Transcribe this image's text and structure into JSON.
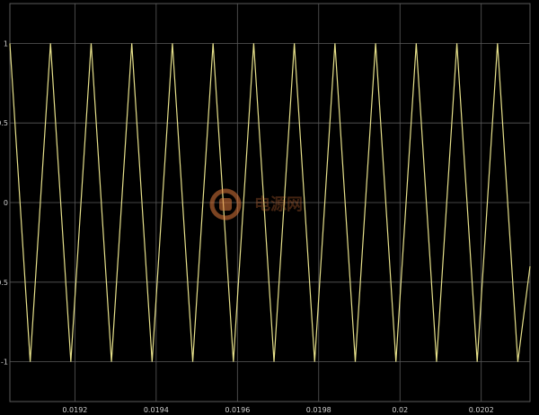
{
  "chart_data": {
    "type": "line",
    "title": "",
    "xlabel": "",
    "ylabel": "",
    "xlim": [
      0.01904,
      0.02032
    ],
    "ylim": [
      -1.25,
      1.25
    ],
    "grid": true,
    "x_ticks": [
      0.0192,
      0.0194,
      0.0196,
      0.0198,
      0.02,
      0.0202
    ],
    "x_tick_labels": [
      "0.0192",
      "0.0194",
      "0.0196",
      "0.0198",
      "0.02",
      "0.0202"
    ],
    "y_ticks": [
      1,
      0.5,
      0,
      -0.5,
      -1
    ],
    "y_tick_labels": [
      "1",
      "0.5",
      "0",
      "-0.5",
      "-1"
    ],
    "series": [
      {
        "color": "#e6e08a",
        "x": [
          0.01904,
          0.01909,
          0.01914,
          0.01919,
          0.01924,
          0.01929,
          0.01934,
          0.01939,
          0.01944,
          0.01949,
          0.01954,
          0.01959,
          0.01964,
          0.01969,
          0.01974,
          0.01979,
          0.01984,
          0.01989,
          0.01994,
          0.01999,
          0.02004,
          0.02009,
          0.02014,
          0.02019,
          0.02024,
          0.02029,
          0.02032
        ],
        "y": [
          1,
          -1,
          1,
          -1,
          1,
          -1,
          1,
          -1,
          1,
          -1,
          1,
          -1,
          1,
          -1,
          1,
          -1,
          1,
          -1,
          1,
          -1,
          1,
          -1,
          1,
          -1,
          1,
          -1,
          -0.4
        ]
      }
    ]
  },
  "watermark": {
    "text": "电源网",
    "color": "#e07a3c"
  },
  "colors": {
    "background": "#000000",
    "grid": "#5a5a5a",
    "tick_text": "#d0d0d0",
    "trace": "#e6e08a"
  }
}
